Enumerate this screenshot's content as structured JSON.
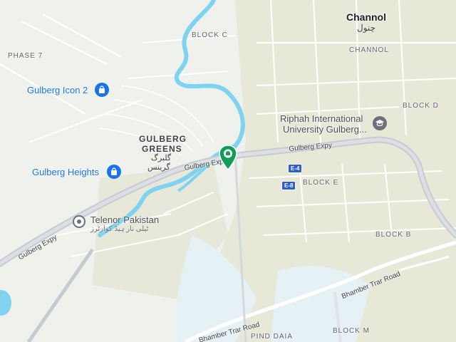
{
  "colors": {
    "land": "#eef1ec",
    "land_tint": "#e6e7d7",
    "water": "#7fd3f0",
    "expressway": "#c7cbd1",
    "road": "#ffffff",
    "poi_blue": "#1a73e8",
    "poi_gray": "#6b7178",
    "marker_green": "#0f9d58",
    "shield_blue": "#2d5fc9"
  },
  "areas": {
    "block_c": "BLOCK C",
    "phase_7": "PHASE 7",
    "channol_en": "Channol",
    "channol_ur": "چنول",
    "channol_caps": "CHANNOL",
    "block_d": "BLOCK D",
    "gulberg_greens_1": "GULBERG",
    "gulberg_greens_2": "GREENS",
    "gulberg_greens_ur_1": "گلبرگ",
    "gulberg_greens_ur_2": "گرینس",
    "block_e": "BLOCK E",
    "block_b": "BLOCK B",
    "pind_daia": "PIND DAIA",
    "block_m": "BLOCK M"
  },
  "pois": {
    "gulberg_icon_2": "Gulberg Icon 2",
    "gulberg_heights": "Gulberg Heights",
    "riphah_1": "Riphah International",
    "riphah_2": "University Gulberg...",
    "telenor": "Telenor Pakistan",
    "telenor_ur": "ٹیلی نار ہیڈ کوارٹرز",
    "bank_icon": "shopping-bag-icon",
    "school_icon": "graduation-cap-icon",
    "place_icon": "place-icon"
  },
  "roads": {
    "gulberg_expy_main": "Gulberg Expy",
    "gulberg_expy_mid": "Gulberg Exp",
    "gulberg_expy_left": "Gulberg Expy",
    "bhamber_trar_1": "Bhamber Trar Road",
    "bhamber_trar_2": "Bhamber Trar Road",
    "shield_e4": "E-4",
    "shield_e8": "E-8"
  },
  "marker": {
    "icon": "location-pin-icon"
  }
}
